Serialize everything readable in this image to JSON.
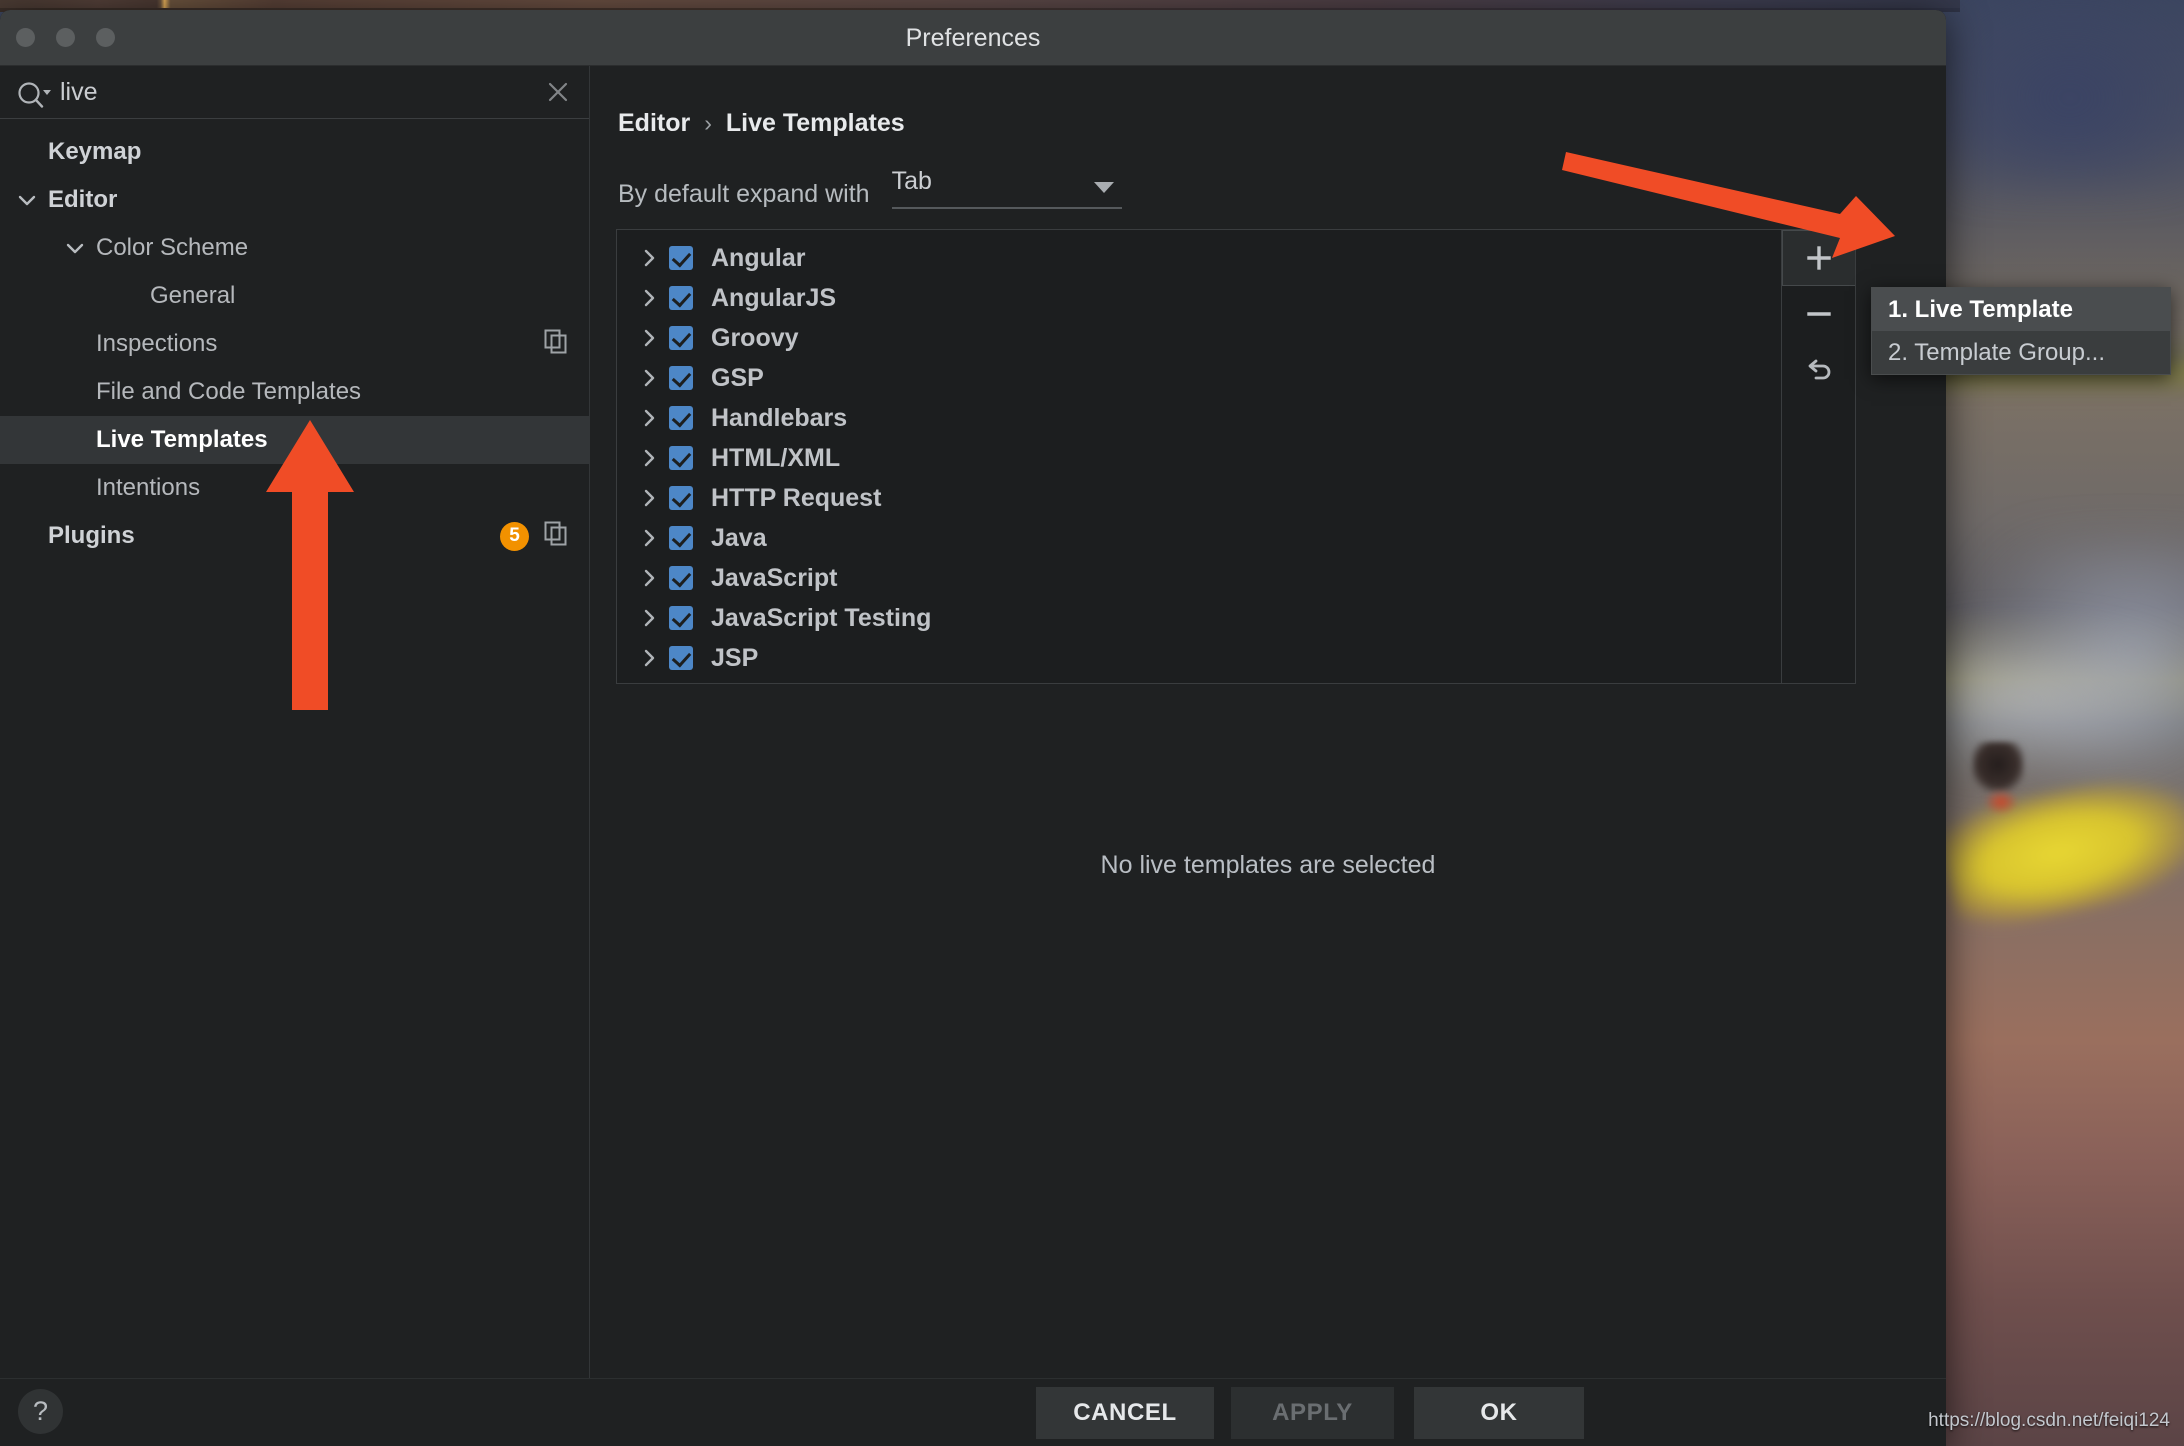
{
  "window": {
    "title": "Preferences",
    "traffic_lights": [
      "close-light",
      "minimize-light",
      "zoom-light"
    ]
  },
  "search": {
    "value": "live",
    "placeholder": "",
    "icon": "search-icon",
    "clear_icon": "clear-icon"
  },
  "sidebar": {
    "items": [
      {
        "label": "Keymap",
        "indent": 0,
        "bold": true,
        "selected": false,
        "arrow": "none",
        "badge": null,
        "copy_icon": false
      },
      {
        "label": "Editor",
        "indent": 0,
        "bold": true,
        "selected": false,
        "arrow": "down",
        "badge": null,
        "copy_icon": false
      },
      {
        "label": "Color Scheme",
        "indent": 1,
        "bold": false,
        "selected": false,
        "arrow": "down",
        "badge": null,
        "copy_icon": false
      },
      {
        "label": "General",
        "indent": 2,
        "bold": false,
        "selected": false,
        "arrow": "none",
        "badge": null,
        "copy_icon": false
      },
      {
        "label": "Inspections",
        "indent": 1,
        "bold": false,
        "selected": false,
        "arrow": "none",
        "badge": null,
        "copy_icon": true
      },
      {
        "label": "File and Code Templates",
        "indent": 1,
        "bold": false,
        "selected": false,
        "arrow": "none",
        "badge": null,
        "copy_icon": false
      },
      {
        "label": "Live Templates",
        "indent": 1,
        "bold": true,
        "selected": true,
        "arrow": "none",
        "badge": null,
        "copy_icon": false
      },
      {
        "label": "Intentions",
        "indent": 1,
        "bold": false,
        "selected": false,
        "arrow": "none",
        "badge": null,
        "copy_icon": false
      },
      {
        "label": "Plugins",
        "indent": 0,
        "bold": true,
        "selected": false,
        "arrow": "none",
        "badge": "5",
        "copy_icon": true
      }
    ]
  },
  "main": {
    "breadcrumb": {
      "root": "Editor",
      "separator": "›",
      "current": "Live Templates"
    },
    "expand_with": {
      "label": "By default expand with",
      "value": "Tab",
      "caret_icon": "chevron-down-icon"
    },
    "templates": [
      {
        "label": "Angular",
        "checked": true
      },
      {
        "label": "AngularJS",
        "checked": true
      },
      {
        "label": "Groovy",
        "checked": true
      },
      {
        "label": "GSP",
        "checked": true
      },
      {
        "label": "Handlebars",
        "checked": true
      },
      {
        "label": "HTML/XML",
        "checked": true
      },
      {
        "label": "HTTP Request",
        "checked": true
      },
      {
        "label": "Java",
        "checked": true
      },
      {
        "label": "JavaScript",
        "checked": true
      },
      {
        "label": "JavaScript Testing",
        "checked": true
      },
      {
        "label": "JSP",
        "checked": true
      }
    ],
    "toolbar": {
      "add": "+",
      "remove": "−",
      "revert": "↶",
      "add_icon": "plus-icon",
      "remove_icon": "minus-icon",
      "revert_icon": "undo-icon"
    },
    "empty_message": "No live templates are selected"
  },
  "popup_menu": {
    "items": [
      {
        "label": "1. Live Template",
        "highlighted": true
      },
      {
        "label": "2. Template Group...",
        "highlighted": false
      }
    ]
  },
  "footer": {
    "help_label": "?",
    "cancel_label": "CANCEL",
    "apply_label": "APPLY",
    "ok_label": "OK",
    "apply_disabled": true
  },
  "annotations": {
    "arrow_color": "#F04C26",
    "arrow_up_target": "Live Templates",
    "arrow_right_target": "plus-icon"
  },
  "watermark": {
    "text": "https://blog.csdn.net/feiqi124"
  },
  "colors": {
    "accent_checkbox": "#4d87c7",
    "badge_orange": "#f29100",
    "arrow_orange": "#F04C26",
    "window_bg": "#1f2122",
    "titlebar_bg": "#3c3f40",
    "selection_bg": "#333638"
  }
}
